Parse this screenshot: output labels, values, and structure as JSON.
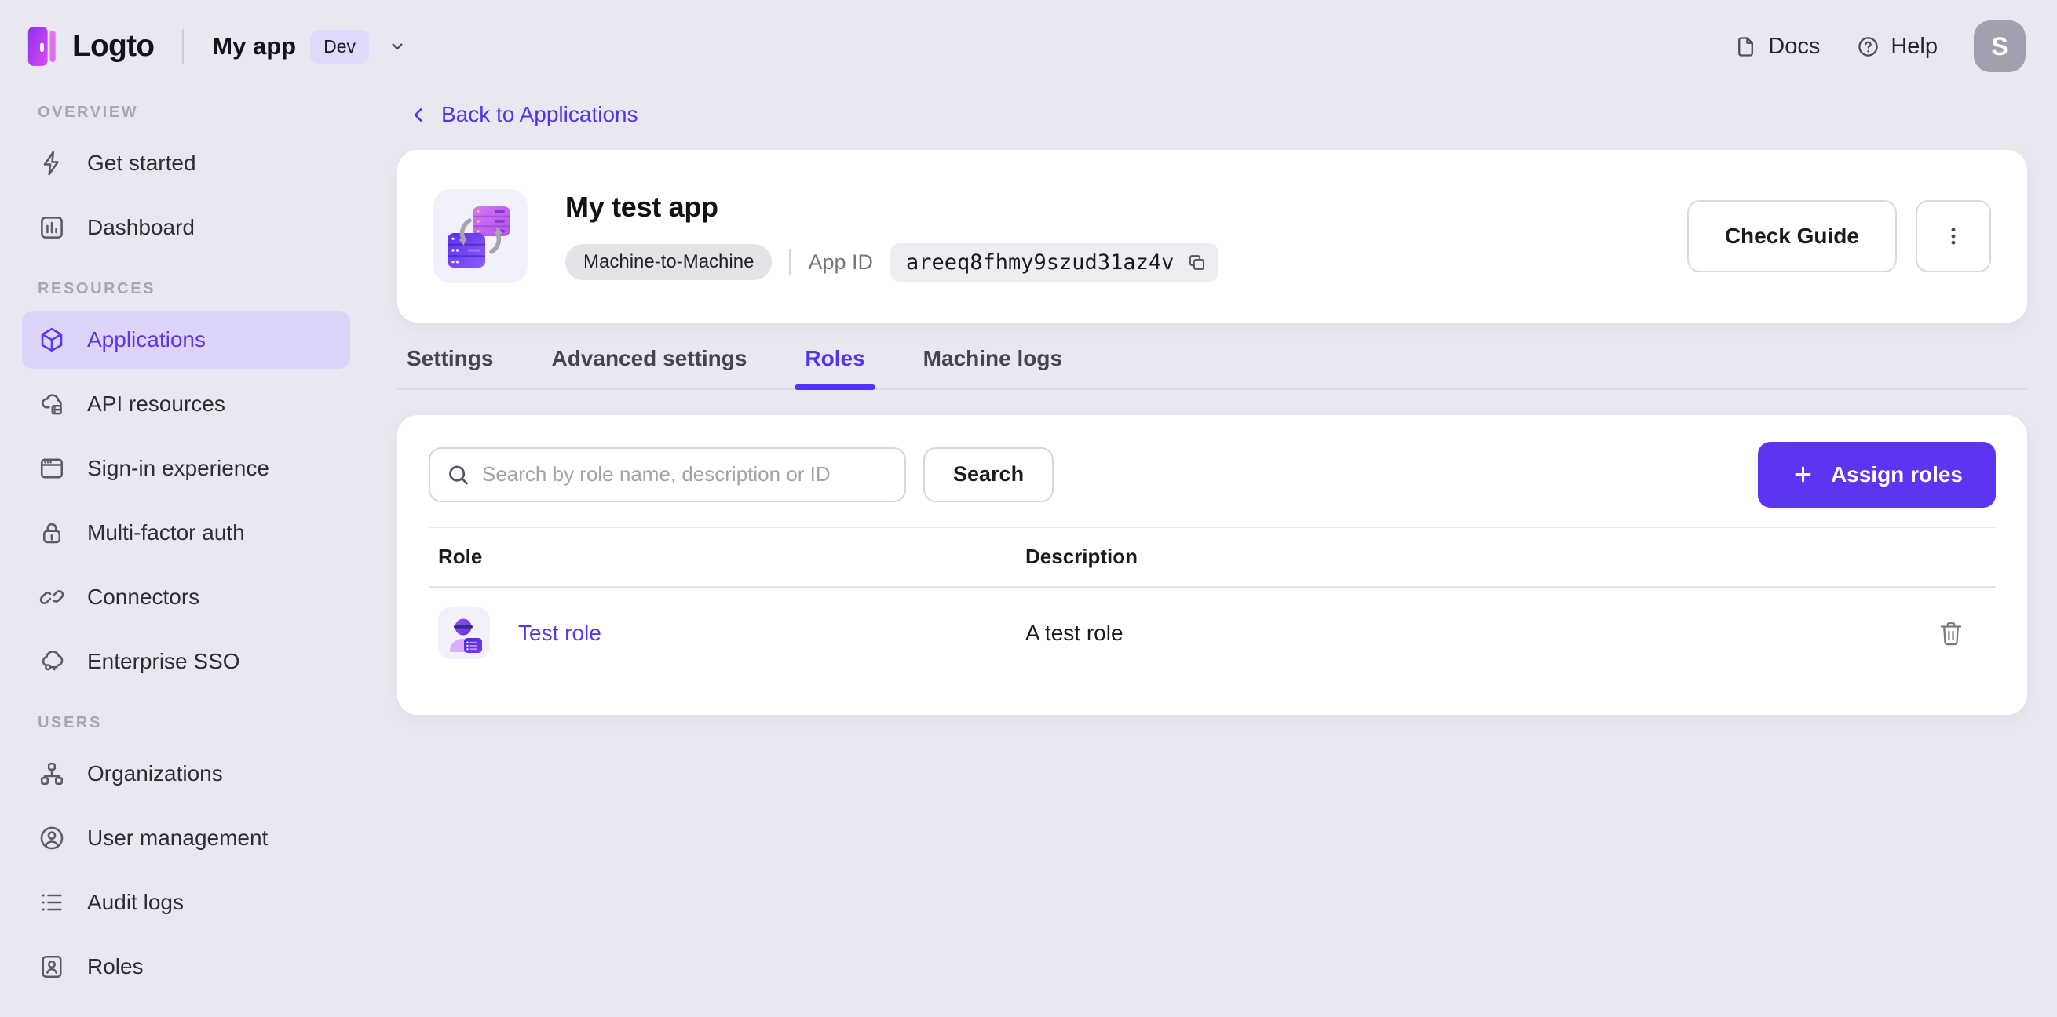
{
  "colors": {
    "accent": "#5d34f2",
    "accent_soft": "#ddd5f9",
    "page_bg": "#e9e8f1",
    "card_bg": "#ffffff",
    "avatar_bg": "#a39fae",
    "env_badge_bg": "#e1d9fb",
    "type_badge_bg": "#e4e3e8"
  },
  "topbar": {
    "brand": "Logto",
    "app_name": "My app",
    "env_badge": "Dev",
    "docs_label": "Docs",
    "help_label": "Help",
    "avatar_initial": "S"
  },
  "sidebar": {
    "sections": [
      {
        "label": "OVERVIEW",
        "items": [
          {
            "label": "Get started",
            "icon": "lightning-icon"
          },
          {
            "label": "Dashboard",
            "icon": "dashboard-icon"
          }
        ]
      },
      {
        "label": "RESOURCES",
        "items": [
          {
            "label": "Applications",
            "icon": "cube-icon",
            "active": true
          },
          {
            "label": "API resources",
            "icon": "cloud-box-icon"
          },
          {
            "label": "Sign-in experience",
            "icon": "browser-icon"
          },
          {
            "label": "Multi-factor auth",
            "icon": "lock-icon"
          },
          {
            "label": "Connectors",
            "icon": "link-icon"
          },
          {
            "label": "Enterprise SSO",
            "icon": "cloud-key-icon"
          }
        ]
      },
      {
        "label": "USERS",
        "items": [
          {
            "label": "Organizations",
            "icon": "org-chart-icon"
          },
          {
            "label": "User management",
            "icon": "user-circle-icon"
          },
          {
            "label": "Audit logs",
            "icon": "list-icon"
          },
          {
            "label": "Roles",
            "icon": "id-card-icon"
          }
        ]
      }
    ]
  },
  "main": {
    "back_link": "Back to Applications",
    "app": {
      "title": "My test app",
      "type_badge": "Machine-to-Machine",
      "app_id_label": "App ID",
      "app_id": "areeq8fhmy9szud31az4v"
    },
    "header_actions": {
      "check_guide": "Check Guide"
    },
    "tabs": [
      {
        "label": "Settings"
      },
      {
        "label": "Advanced settings"
      },
      {
        "label": "Roles",
        "active": true
      },
      {
        "label": "Machine logs"
      }
    ],
    "toolbar": {
      "search_placeholder": "Search by role name, description or ID",
      "search_button": "Search",
      "assign_button": "Assign roles"
    },
    "table": {
      "columns": [
        "Role",
        "Description"
      ],
      "rows": [
        {
          "role": "Test role",
          "description": "A test role"
        }
      ]
    }
  }
}
